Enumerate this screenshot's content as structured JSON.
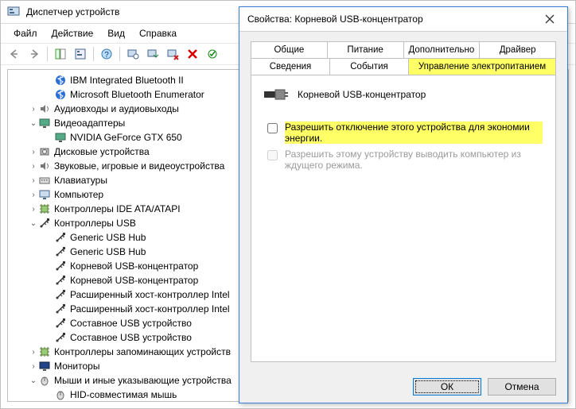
{
  "bgWindow": {
    "title": "Диспетчер устройств",
    "menu": {
      "file": "Файл",
      "action": "Действие",
      "view": "Вид",
      "help": "Справка"
    }
  },
  "tree": [
    {
      "lvl": 2,
      "exp": "",
      "icon": "bt",
      "label": "IBM Integrated Bluetooth II"
    },
    {
      "lvl": 2,
      "exp": "",
      "icon": "bt",
      "label": "Microsoft Bluetooth Enumerator"
    },
    {
      "lvl": 1,
      "exp": ">",
      "icon": "audio",
      "label": "Аудиовходы и аудиовыходы"
    },
    {
      "lvl": 1,
      "exp": "v",
      "icon": "display",
      "label": "Видеоадаптеры"
    },
    {
      "lvl": 2,
      "exp": "",
      "icon": "display",
      "label": "NVIDIA GeForce GTX 650"
    },
    {
      "lvl": 1,
      "exp": ">",
      "icon": "disk",
      "label": "Дисковые устройства"
    },
    {
      "lvl": 1,
      "exp": ">",
      "icon": "audio",
      "label": "Звуковые, игровые и видеоустройства"
    },
    {
      "lvl": 1,
      "exp": ">",
      "icon": "keyboard",
      "label": "Клавиатуры"
    },
    {
      "lvl": 1,
      "exp": ">",
      "icon": "computer",
      "label": "Компьютер"
    },
    {
      "lvl": 1,
      "exp": ">",
      "icon": "ide",
      "label": "Контроллеры IDE ATA/ATAPI"
    },
    {
      "lvl": 1,
      "exp": "v",
      "icon": "usb",
      "label": "Контроллеры USB"
    },
    {
      "lvl": 2,
      "exp": "",
      "icon": "usb",
      "label": "Generic USB Hub"
    },
    {
      "lvl": 2,
      "exp": "",
      "icon": "usb",
      "label": "Generic USB Hub"
    },
    {
      "lvl": 2,
      "exp": "",
      "icon": "usb",
      "label": "Корневой USB-концентратор"
    },
    {
      "lvl": 2,
      "exp": "",
      "icon": "usb",
      "label": "Корневой USB-концентратор"
    },
    {
      "lvl": 2,
      "exp": "",
      "icon": "usb",
      "label": "Расширенный хост-контроллер Intel"
    },
    {
      "lvl": 2,
      "exp": "",
      "icon": "usb",
      "label": "Расширенный хост-контроллер Intel"
    },
    {
      "lvl": 2,
      "exp": "",
      "icon": "usb",
      "label": "Составное USB устройство"
    },
    {
      "lvl": 2,
      "exp": "",
      "icon": "usb",
      "label": "Составное USB устройство"
    },
    {
      "lvl": 1,
      "exp": ">",
      "icon": "storage",
      "label": "Контроллеры запоминающих устройств"
    },
    {
      "lvl": 1,
      "exp": ">",
      "icon": "monitor",
      "label": "Мониторы"
    },
    {
      "lvl": 1,
      "exp": "v",
      "icon": "mouse",
      "label": "Мыши и иные указывающие устройства"
    },
    {
      "lvl": 2,
      "exp": "",
      "icon": "mouse",
      "label": "HID-совместимая мышь"
    }
  ],
  "dialog": {
    "title": "Свойства: Корневой USB-концентратор",
    "tabs": {
      "general": "Общие",
      "power": "Питание",
      "advanced": "Дополнительно",
      "driver": "Драйвер",
      "details": "Сведения",
      "events": "События",
      "powerMgmt": "Управление электропитанием"
    },
    "deviceName": "Корневой USB-концентратор",
    "opt1": "Разрешить отключение этого устройства для экономии энергии.",
    "opt2": "Разрешить этому устройству выводить компьютер из ждущего режима.",
    "buttons": {
      "ok": "ОК",
      "cancel": "Отмена"
    }
  },
  "icons": {
    "usb": "usb-plug",
    "bt": "bluetooth",
    "audio": "speaker",
    "display": "monitor-card",
    "disk": "hdd",
    "keyboard": "keyboard",
    "computer": "computer",
    "ide": "chip",
    "storage": "chip",
    "monitor": "monitor",
    "mouse": "mouse"
  }
}
